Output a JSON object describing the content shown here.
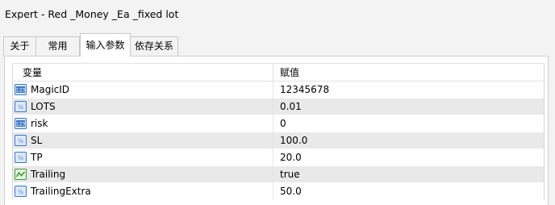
{
  "window": {
    "title": "Expert - Red _Money _Ea _fixed lot"
  },
  "tabs": [
    {
      "label": "关于",
      "active": false
    },
    {
      "label": "常用",
      "active": false
    },
    {
      "label": "输入参数",
      "active": true
    },
    {
      "label": "依存关系",
      "active": false
    }
  ],
  "table": {
    "columns": {
      "variable": "变量",
      "value": "赋值"
    },
    "rows": [
      {
        "name": "MagicID",
        "value": "12345678",
        "icon": "integer-icon"
      },
      {
        "name": "LOTS",
        "value": "0.01",
        "icon": "double-icon"
      },
      {
        "name": "risk",
        "value": "0",
        "icon": "integer-icon"
      },
      {
        "name": "SL",
        "value": "100.0",
        "icon": "double-icon"
      },
      {
        "name": "TP",
        "value": "20.0",
        "icon": "double-icon"
      },
      {
        "name": "Trailing",
        "value": "true",
        "icon": "bool-icon"
      },
      {
        "name": "TrailingExtra",
        "value": "50.0",
        "icon": "double-icon"
      }
    ]
  },
  "colors": {
    "icon_blue": "#3b78c8",
    "icon_green": "#3f9a37",
    "row_alt": "#e9e9e9"
  }
}
